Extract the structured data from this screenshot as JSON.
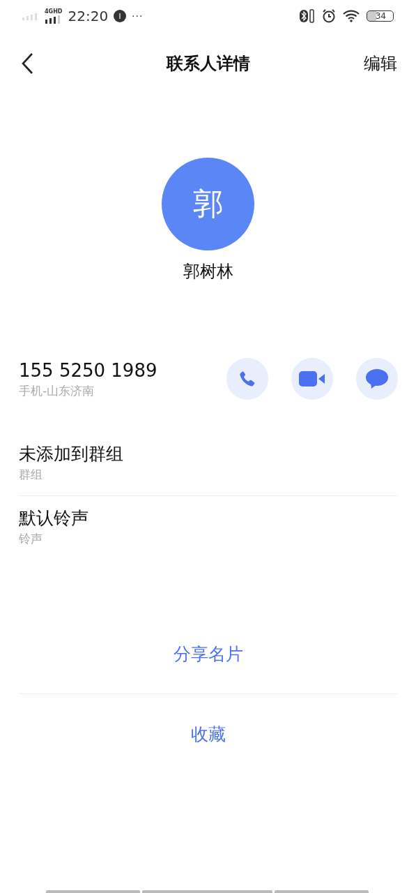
{
  "status_bar": {
    "network": "4GHD",
    "time": "22:20",
    "more": "···",
    "battery": "34"
  },
  "header": {
    "title": "联系人详情",
    "edit": "编辑"
  },
  "contact": {
    "avatar": "郭",
    "name": "郭树林"
  },
  "phone": {
    "number": "155 5250 1989",
    "label": "手机-山东济南",
    "actions": [
      {
        "kind": "call"
      },
      {
        "kind": "video"
      },
      {
        "kind": "message"
      }
    ]
  },
  "rows": [
    {
      "value": "未添加到群组",
      "label": "群组"
    },
    {
      "value": "默认铃声",
      "label": "铃声"
    }
  ],
  "links": [
    "分享名片",
    "收藏"
  ]
}
